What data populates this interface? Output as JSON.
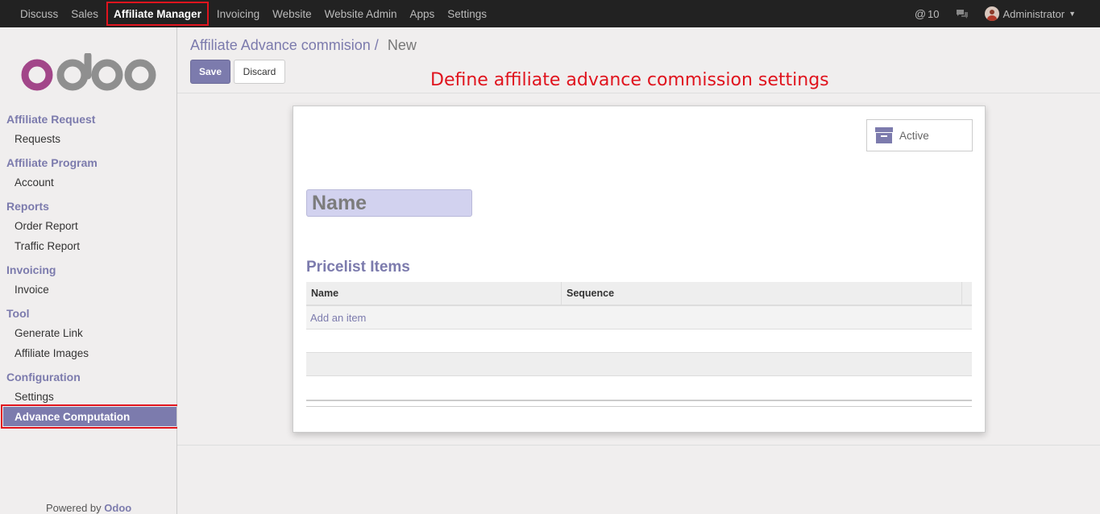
{
  "topbar": {
    "menu": [
      "Discuss",
      "Sales",
      "Affiliate Manager",
      "Invoicing",
      "Website",
      "Website Admin",
      "Apps",
      "Settings"
    ],
    "active_menu": "Affiliate Manager",
    "messages_count": "10",
    "user": "Administrator"
  },
  "sidebar": {
    "logo": "odoo",
    "sections": [
      {
        "title": "Affiliate Request",
        "items": [
          "Requests"
        ]
      },
      {
        "title": "Affiliate Program",
        "items": [
          "Account"
        ]
      },
      {
        "title": "Reports",
        "items": [
          "Order Report",
          "Traffic Report"
        ]
      },
      {
        "title": "Invoicing",
        "items": [
          "Invoice"
        ]
      },
      {
        "title": "Tool",
        "items": [
          "Generate Link",
          "Affiliate Images"
        ]
      },
      {
        "title": "Configuration",
        "items": [
          "Settings",
          "Advance Computation"
        ]
      }
    ],
    "active_item": "Advance Computation",
    "powered_by": "Powered by",
    "powered_brand": "Odoo"
  },
  "control": {
    "breadcrumb_parent": "Affiliate Advance commision",
    "breadcrumb_sep": "/",
    "breadcrumb_current": "New",
    "save_label": "Save",
    "discard_label": "Discard"
  },
  "annotation": "Define affiliate advance commission settings",
  "form": {
    "active_label": "Active",
    "name_placeholder": "Name",
    "section_title": "Pricelist Items",
    "columns": [
      "Name",
      "Sequence"
    ],
    "add_item": "Add an item"
  },
  "colors": {
    "accent": "#7c7bad",
    "highlight": "#e0141e",
    "topbar": "#222222"
  }
}
